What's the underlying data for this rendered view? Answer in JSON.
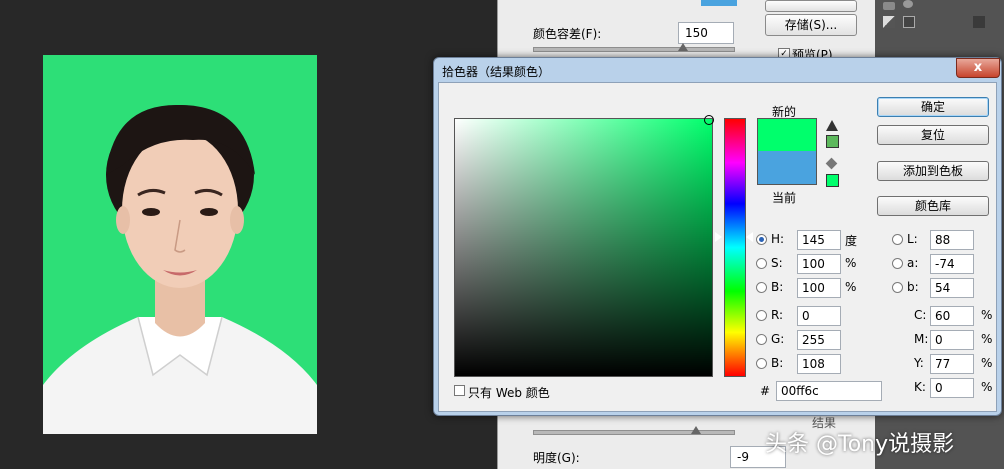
{
  "color_range": {
    "top_button": "",
    "save_button": "存储(S)...",
    "tolerance_label": "颜色容差(F):",
    "tolerance_value": "150",
    "preview_label": "预览(P)",
    "result_label": "结果",
    "brightness_label": "明度(G):",
    "brightness_value": "-9"
  },
  "picker": {
    "title": "拾色器（结果颜色）",
    "close_glyph": "x",
    "new_label": "新的",
    "current_label": "当前",
    "new_color": "#00ff6c",
    "current_color": "#4aa3df",
    "ok_label": "确定",
    "reset_label": "复位",
    "add_swatch_label": "添加到色板",
    "library_label": "颜色库",
    "web_only_label": "只有 Web 颜色",
    "hex_label": "#",
    "hex_value": "00ff6c",
    "hsb": [
      {
        "label": "H:",
        "value": "145",
        "unit": "度"
      },
      {
        "label": "S:",
        "value": "100",
        "unit": "%"
      },
      {
        "label": "B:",
        "value": "100",
        "unit": "%"
      }
    ],
    "rgb": [
      {
        "label": "R:",
        "value": "0"
      },
      {
        "label": "G:",
        "value": "255"
      },
      {
        "label": "B:",
        "value": "108"
      }
    ],
    "lab": [
      {
        "label": "L:",
        "value": "88"
      },
      {
        "label": "a:",
        "value": "-74"
      },
      {
        "label": "b:",
        "value": "54"
      }
    ],
    "cmyk": [
      {
        "label": "C:",
        "value": "60",
        "unit": "%"
      },
      {
        "label": "M:",
        "value": "0",
        "unit": "%"
      },
      {
        "label": "Y:",
        "value": "77",
        "unit": "%"
      },
      {
        "label": "K:",
        "value": "0",
        "unit": "%"
      }
    ]
  },
  "watermark": "头条 @Tony说摄影",
  "colors": {
    "photo_bg": "#2ddf77",
    "dialog_frame": "#b9d1ea"
  }
}
